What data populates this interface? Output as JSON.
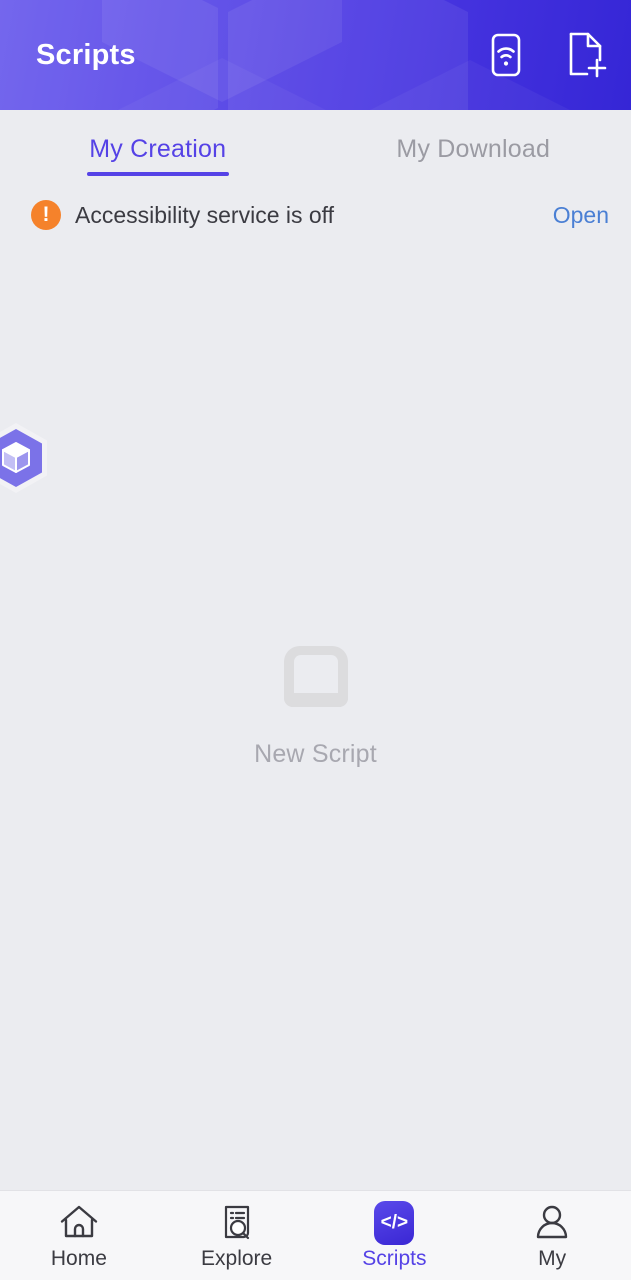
{
  "header": {
    "title": "Scripts",
    "icons": [
      {
        "name": "device-wifi-icon",
        "label": "Wireless connect"
      },
      {
        "name": "new-document-icon",
        "label": "New file"
      }
    ],
    "gradient_from": "#6a5cec",
    "gradient_to": "#3526d6"
  },
  "tabs": [
    {
      "label": "My Creation",
      "active": true
    },
    {
      "label": "My Download",
      "active": false
    }
  ],
  "warning": {
    "icon": "alert-circle-icon",
    "icon_glyph": "!",
    "text": "Accessibility service is off",
    "action_label": "Open",
    "icon_color": "#f5822b",
    "action_color": "#4a7fd4"
  },
  "floating_badge": {
    "name": "cube-badge-icon",
    "color": "#7b72e8"
  },
  "empty_state": {
    "icon": "empty-tray-icon",
    "label": "New Script",
    "icon_color": "#dcdcde",
    "label_color": "#a8a8b0"
  },
  "bottom_nav": [
    {
      "label": "Home",
      "icon": "home-icon",
      "active": false
    },
    {
      "label": "Explore",
      "icon": "explore-document-search-icon",
      "active": false
    },
    {
      "label": "Scripts",
      "icon": "code-brackets-icon",
      "icon_glyph": "</>",
      "active": true
    },
    {
      "label": "My",
      "icon": "person-icon",
      "active": false
    }
  ],
  "theme": {
    "accent": "#5542e6",
    "page_background": "#ebecf0",
    "nav_background": "#f7f7f9"
  }
}
